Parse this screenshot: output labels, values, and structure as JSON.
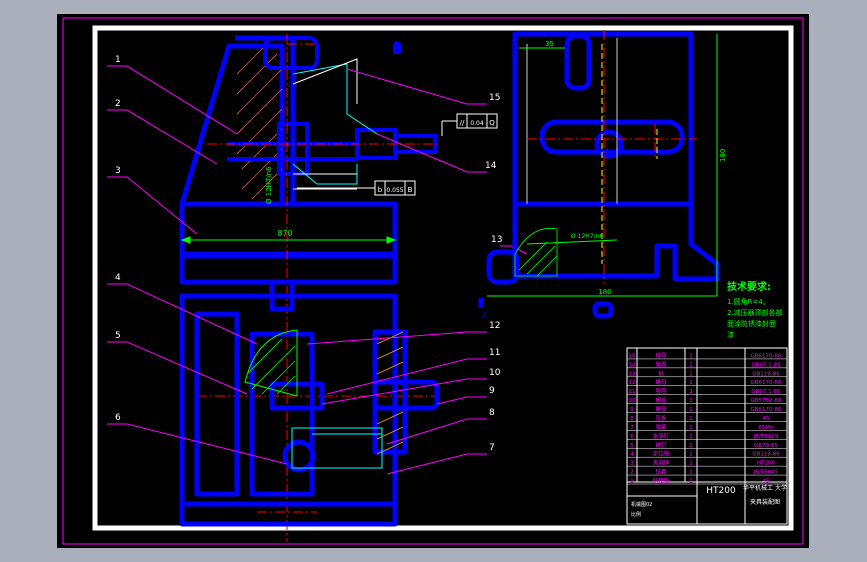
{
  "balloons": [
    "1",
    "2",
    "3",
    "4",
    "5",
    "6",
    "7",
    "8",
    "9",
    "10",
    "11",
    "12",
    "13",
    "14",
    "15"
  ],
  "dims": {
    "width_main": "870",
    "fit_left": "Ø 12H7/n6",
    "fit_right": "Ø 12H7/n6",
    "width_bottom": "180",
    "height_right": "180",
    "top_small": "35"
  },
  "tolerance": {
    "frame1": [
      "//",
      "0.04",
      "Q"
    ],
    "frame2": [
      "b",
      "0.055",
      "B"
    ]
  },
  "datum_a": "A",
  "notes": {
    "title": "技术要求:",
    "lines": [
      "1.圆角R=4。",
      "2.减压器顶部各部",
      "  面涂防锈漆封面",
      "  漆"
    ]
  },
  "title_block": {
    "material": "HT200",
    "top_right": "华平机械工 大学",
    "drawing_name": "夹具装配图",
    "left_small": "机械图02",
    "left_small2": "比例"
  },
  "parts_list": [
    [
      "15",
      "螺母",
      "1",
      "GB6170-86"
    ],
    [
      "14",
      "垫圈",
      "1",
      "GB97.1-85"
    ],
    [
      "13",
      "销",
      "1",
      "GB119-86"
    ],
    [
      "12",
      "螺母",
      "1",
      "GB6170-86"
    ],
    [
      "11",
      "垫圈",
      "2",
      "GB97.1-85"
    ],
    [
      "10",
      "螺栓",
      "1",
      "GB5782-86"
    ],
    [
      "9",
      "螺母",
      "1",
      "GB6170-86"
    ],
    [
      "8",
      "压板",
      "1",
      "45"
    ],
    [
      "7",
      "弹簧",
      "1",
      "65Mn"
    ],
    [
      "6",
      "支承钉",
      "1",
      "JB/T8029"
    ],
    [
      "5",
      "螺钉",
      "1",
      "GB70-85"
    ],
    [
      "4",
      "定位销",
      "1",
      "GB119-86"
    ],
    [
      "3",
      "夹具体",
      "1",
      "HT200"
    ],
    [
      "2",
      "钻套",
      "1",
      "JB/T8045"
    ],
    [
      "1",
      "钻模板",
      "1",
      "45"
    ]
  ]
}
